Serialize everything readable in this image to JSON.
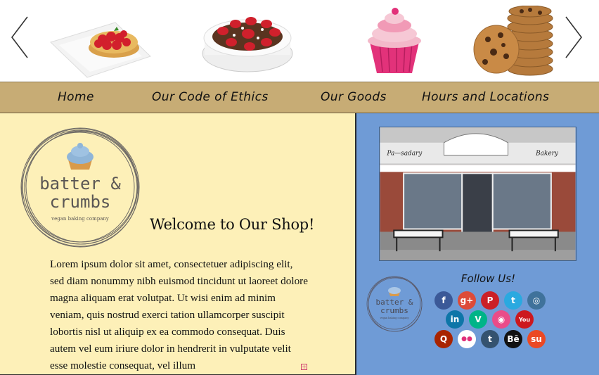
{
  "carousel": {
    "prev_icon": "chevron-left-icon",
    "next_icon": "chevron-right-icon",
    "slides": [
      "strawberry-tart",
      "strawberry-cake",
      "pink-cupcake",
      "cookie-stack"
    ]
  },
  "nav": {
    "items": [
      {
        "label": "Home"
      },
      {
        "label": "Our Code of Ethics"
      },
      {
        "label": "Our Goods"
      },
      {
        "label": "Hours and Locations"
      }
    ]
  },
  "logo": {
    "line1": "batter &",
    "line2": "crumbs",
    "tagline": "vegan baking company"
  },
  "main": {
    "heading": "Welcome to Our Shop!",
    "body": "Lorem ipsum dolor sit amet, consectetuer adipiscing elit, sed diam nonummy nibh euismod tincidunt ut laoreet dolore magna aliquam erat volutpat. Ut wisi enim ad minim veniam, quis nostrud exerci tation ullamcorper suscipit lobortis nisl ut aliquip ex ea commodo consequat. Duis autem vel eum iriure dolor in hendrerit in vulputate velit esse molestie consequat, vel illum"
  },
  "sidebar": {
    "storefront": {
      "left_window": "Pa—sadary",
      "right_window": "Bakery"
    },
    "follow_title": "Follow Us!",
    "social": [
      {
        "name": "facebook",
        "glyph": "f",
        "color": "#3b5998"
      },
      {
        "name": "google-plus",
        "glyph": "g+",
        "color": "#dd4b39"
      },
      {
        "name": "pinterest",
        "glyph": "P",
        "color": "#cb2027"
      },
      {
        "name": "twitter",
        "glyph": "t",
        "color": "#2aa9e0"
      },
      {
        "name": "instagram",
        "glyph": "◎",
        "color": "#3f729b"
      },
      {
        "name": "linkedin",
        "glyph": "in",
        "color": "#0e76a8"
      },
      {
        "name": "vine",
        "glyph": "V",
        "color": "#00b488"
      },
      {
        "name": "dribbble",
        "glyph": "◉",
        "color": "#ea4c89"
      },
      {
        "name": "youtube",
        "glyph": "You",
        "color": "#cc181e"
      },
      {
        "name": "quora",
        "glyph": "Q",
        "color": "#a82400"
      },
      {
        "name": "flickr",
        "glyph": "●●",
        "color": "#ffffff"
      },
      {
        "name": "tumblr",
        "glyph": "t",
        "color": "#34526f"
      },
      {
        "name": "behance",
        "glyph": "Bē",
        "color": "#111111"
      },
      {
        "name": "stumbleupon",
        "glyph": "su",
        "color": "#eb4924"
      }
    ]
  }
}
